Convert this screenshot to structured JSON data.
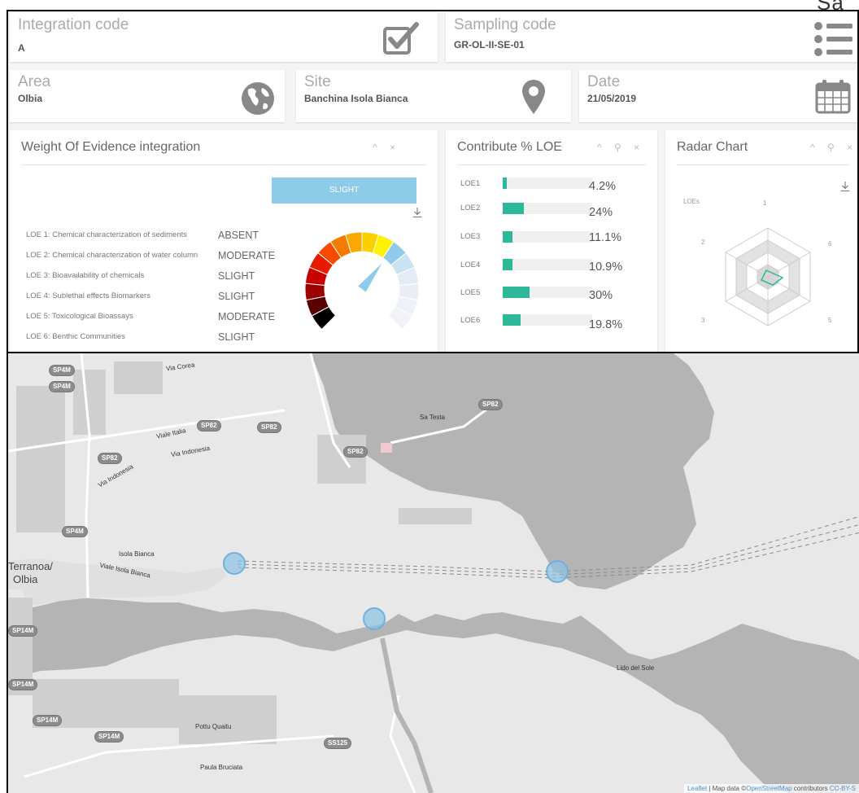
{
  "cut_text": "Sa",
  "info_cards": {
    "integration": {
      "title": "Integration code",
      "value": "A",
      "icon": "checkbox-icon"
    },
    "sampling": {
      "title": "Sampling code",
      "value": "GR-OL-II-SE-01",
      "icon": "list-icon"
    },
    "area": {
      "title": "Area",
      "value": "Olbia",
      "icon": "globe-icon"
    },
    "site": {
      "title": "Site",
      "value": "Banchina Isola Bianca",
      "icon": "map-pin-icon"
    },
    "date": {
      "title": "Date",
      "value": "21/05/2019",
      "icon": "calendar-icon"
    }
  },
  "woe_panel": {
    "title": "Weight Of Evidence integration",
    "controls": "^ ×",
    "result": "SLIGHT",
    "download_icon": "download-icon",
    "rows": [
      {
        "label": "LOE 1: Chemical characterization of sediments",
        "value": "ABSENT"
      },
      {
        "label": "LOE 2: Chemical characterization of water column",
        "value": "MODERATE"
      },
      {
        "label": "LOE 3: Bioavailability of chemicals",
        "value": "SLIGHT"
      },
      {
        "label": "LOE 4: Sublethal effects Biomarkers",
        "value": "SLIGHT"
      },
      {
        "label": "LOE 5: Toxicological Bioassays",
        "value": "MODERATE"
      },
      {
        "label": "LOE 6: Benthic Communities",
        "value": "SLIGHT"
      }
    ],
    "gauge_colors": [
      "#f1f3f8",
      "#eef1f7",
      "#e9eef6",
      "#e5ebf4",
      "#c9e3f3",
      "#8dcbe8",
      "#fff200",
      "#fbd000",
      "#f9a800",
      "#f77a00",
      "#f54a00",
      "#e81a00",
      "#c80000",
      "#9c0000",
      "#5a0000",
      "#000000"
    ],
    "gauge_needle_level": 0.36
  },
  "loe_panel": {
    "title": "Contribute % LOE",
    "controls": "^ ⚲ ×",
    "bar_color": "#2eb89a",
    "rows": [
      {
        "label": "LOE1",
        "pct_text": "4.2%",
        "value": 4.2
      },
      {
        "label": "LOE2",
        "pct_text": "24%",
        "value": 24
      },
      {
        "label": "LOE3",
        "pct_text": "11.1%",
        "value": 11.1
      },
      {
        "label": "LOE4",
        "pct_text": "10.9%",
        "value": 10.9
      },
      {
        "label": "LOE5",
        "pct_text": "30%",
        "value": 30
      },
      {
        "label": "LOE6",
        "pct_text": "19.8%",
        "value": 19.8
      }
    ],
    "scale_max": 100
  },
  "radar_panel": {
    "title": "Radar Chart",
    "controls": "^ ⚲ ×",
    "download_icon": "download-icon",
    "series_label": "LOEs",
    "axis_labels": [
      "1",
      "2",
      "3",
      "5",
      "6"
    ],
    "series_color": "#2eb89a"
  },
  "map": {
    "labels": [
      "Via Corea",
      "Viale Italia",
      "Via Indonesia",
      "Via Indonesia",
      "Sa Testa",
      "Isola Bianca",
      "Viale Isola Bianca",
      "Terranoa/",
      "Olbia",
      "Lido del Sole",
      "Pottu Quaitu",
      "Paula Bruciata"
    ],
    "road_badges": [
      "SP4M",
      "SP4M",
      "SP82",
      "SP82",
      "SP82",
      "SP82",
      "SP82",
      "SP4M",
      "SP14M",
      "SP14M",
      "SP14M",
      "SP14M",
      "SS125"
    ],
    "attribution": {
      "leaflet": "Leaflet",
      "mapdata": "| Map data ©",
      "osm": "OpenStreetMap",
      "contrib": " contributors ",
      "license": "CC-BY-S"
    }
  }
}
